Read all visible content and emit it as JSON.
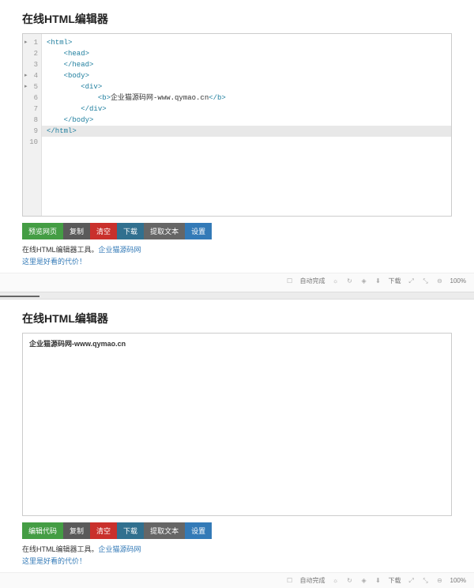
{
  "title": "在线HTML编辑器",
  "code": {
    "lines": [
      "1",
      "2",
      "3",
      "4",
      "5",
      "6",
      "7",
      "8",
      "9",
      "10"
    ],
    "l1": "<html>",
    "l2_indent": "    ",
    "l2": "<head>",
    "l3_indent": "    ",
    "l3": "</head>",
    "l4_indent": "    ",
    "l4": "<body>",
    "l5_indent": "        ",
    "l5": "<div>",
    "l6_indent": "            ",
    "l6a": "<b>",
    "l6b": "企业猫源码网-www.qymao.cn",
    "l6c": "</b>",
    "l7_indent": "        ",
    "l7": "</div>",
    "l8_indent": "    ",
    "l8": "</body>",
    "l9": "</html>"
  },
  "preview_text": "企业猫源码网-www.qymao.cn",
  "buttons": {
    "preview": "预览网页",
    "edit": "编辑代码",
    "copy": "复制",
    "clear": "清空",
    "download": "下载",
    "extract": "提取文本",
    "settings": "设置"
  },
  "credit_prefix": "在线HTML编辑器工具。",
  "credit_link": "企业猫源码网",
  "note": "这里是好看的代价！",
  "footer": {
    "auto": "自动完成",
    "download": "下载",
    "zoom": "100%"
  }
}
